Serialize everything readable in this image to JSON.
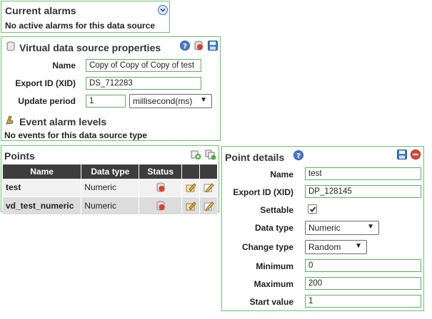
{
  "current_alarms": {
    "title": "Current alarms",
    "message": "No active alarms for this data source"
  },
  "ds_properties": {
    "title": "Virtual data source properties",
    "name_label": "Name",
    "name_value": "Copy of Copy of Copy of test",
    "xid_label": "Export ID (XID)",
    "xid_value": "DS_712283",
    "period_label": "Update period",
    "period_value": "1",
    "period_unit": "millisecond(ms)"
  },
  "event_levels": {
    "title": "Event alarm levels",
    "message": "No events for this data source type"
  },
  "points": {
    "title": "Points",
    "columns": [
      "Name",
      "Data type",
      "Status"
    ],
    "rows": [
      {
        "name": "test",
        "data_type": "Numeric"
      },
      {
        "name": "vd_test_numeric",
        "data_type": "Numeric"
      }
    ]
  },
  "point_details": {
    "title": "Point details",
    "name_label": "Name",
    "name_value": "test",
    "xid_label": "Export ID (XID)",
    "xid_value": "DP_128145",
    "settable_label": "Settable",
    "settable_checked": true,
    "data_type_label": "Data type",
    "data_type_value": "Numeric",
    "change_type_label": "Change type",
    "change_type_value": "Random",
    "minimum_label": "Minimum",
    "minimum_value": "0",
    "maximum_label": "Maximum",
    "maximum_value": "200",
    "start_label": "Start value",
    "start_value": "1"
  }
}
